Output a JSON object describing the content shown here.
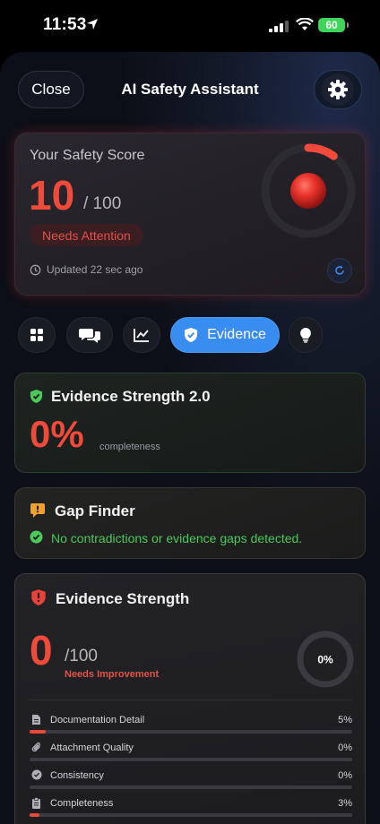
{
  "status_bar": {
    "time": "11:53",
    "battery": "60"
  },
  "header": {
    "close_label": "Close",
    "title": "AI Safety Assistant"
  },
  "score_card": {
    "label": "Your Safety Score",
    "score": "10",
    "out_of": "/ 100",
    "badge": "Needs Attention",
    "updated": "Updated 22 sec ago",
    "ring_fraction": 0.1
  },
  "tabs": {
    "active_label": "Evidence",
    "items": [
      "dashboard",
      "chat",
      "analytics",
      "evidence",
      "tips"
    ]
  },
  "evidence_strength_v2": {
    "title": "Evidence Strength 2.0",
    "percent": "0%",
    "caption": "completeness"
  },
  "gap_finder": {
    "title": "Gap Finder",
    "message": "No contradictions or evidence gaps detected."
  },
  "evidence_strength": {
    "title": "Evidence Strength",
    "score": "0",
    "out_of": "/100",
    "status": "Needs Improvement",
    "ring_label": "0%",
    "metrics": [
      {
        "name": "Documentation Detail",
        "pct_label": "5%",
        "value": 0.05
      },
      {
        "name": "Attachment Quality",
        "pct_label": "0%",
        "value": 0
      },
      {
        "name": "Consistency",
        "pct_label": "0%",
        "value": 0
      },
      {
        "name": "Completeness",
        "pct_label": "3%",
        "value": 0.03
      }
    ]
  },
  "colors": {
    "accent_blue": "#3a8df0",
    "danger_red": "#f04a3a",
    "success_green": "#4cc85c",
    "warning_orange": "#f0a030"
  }
}
